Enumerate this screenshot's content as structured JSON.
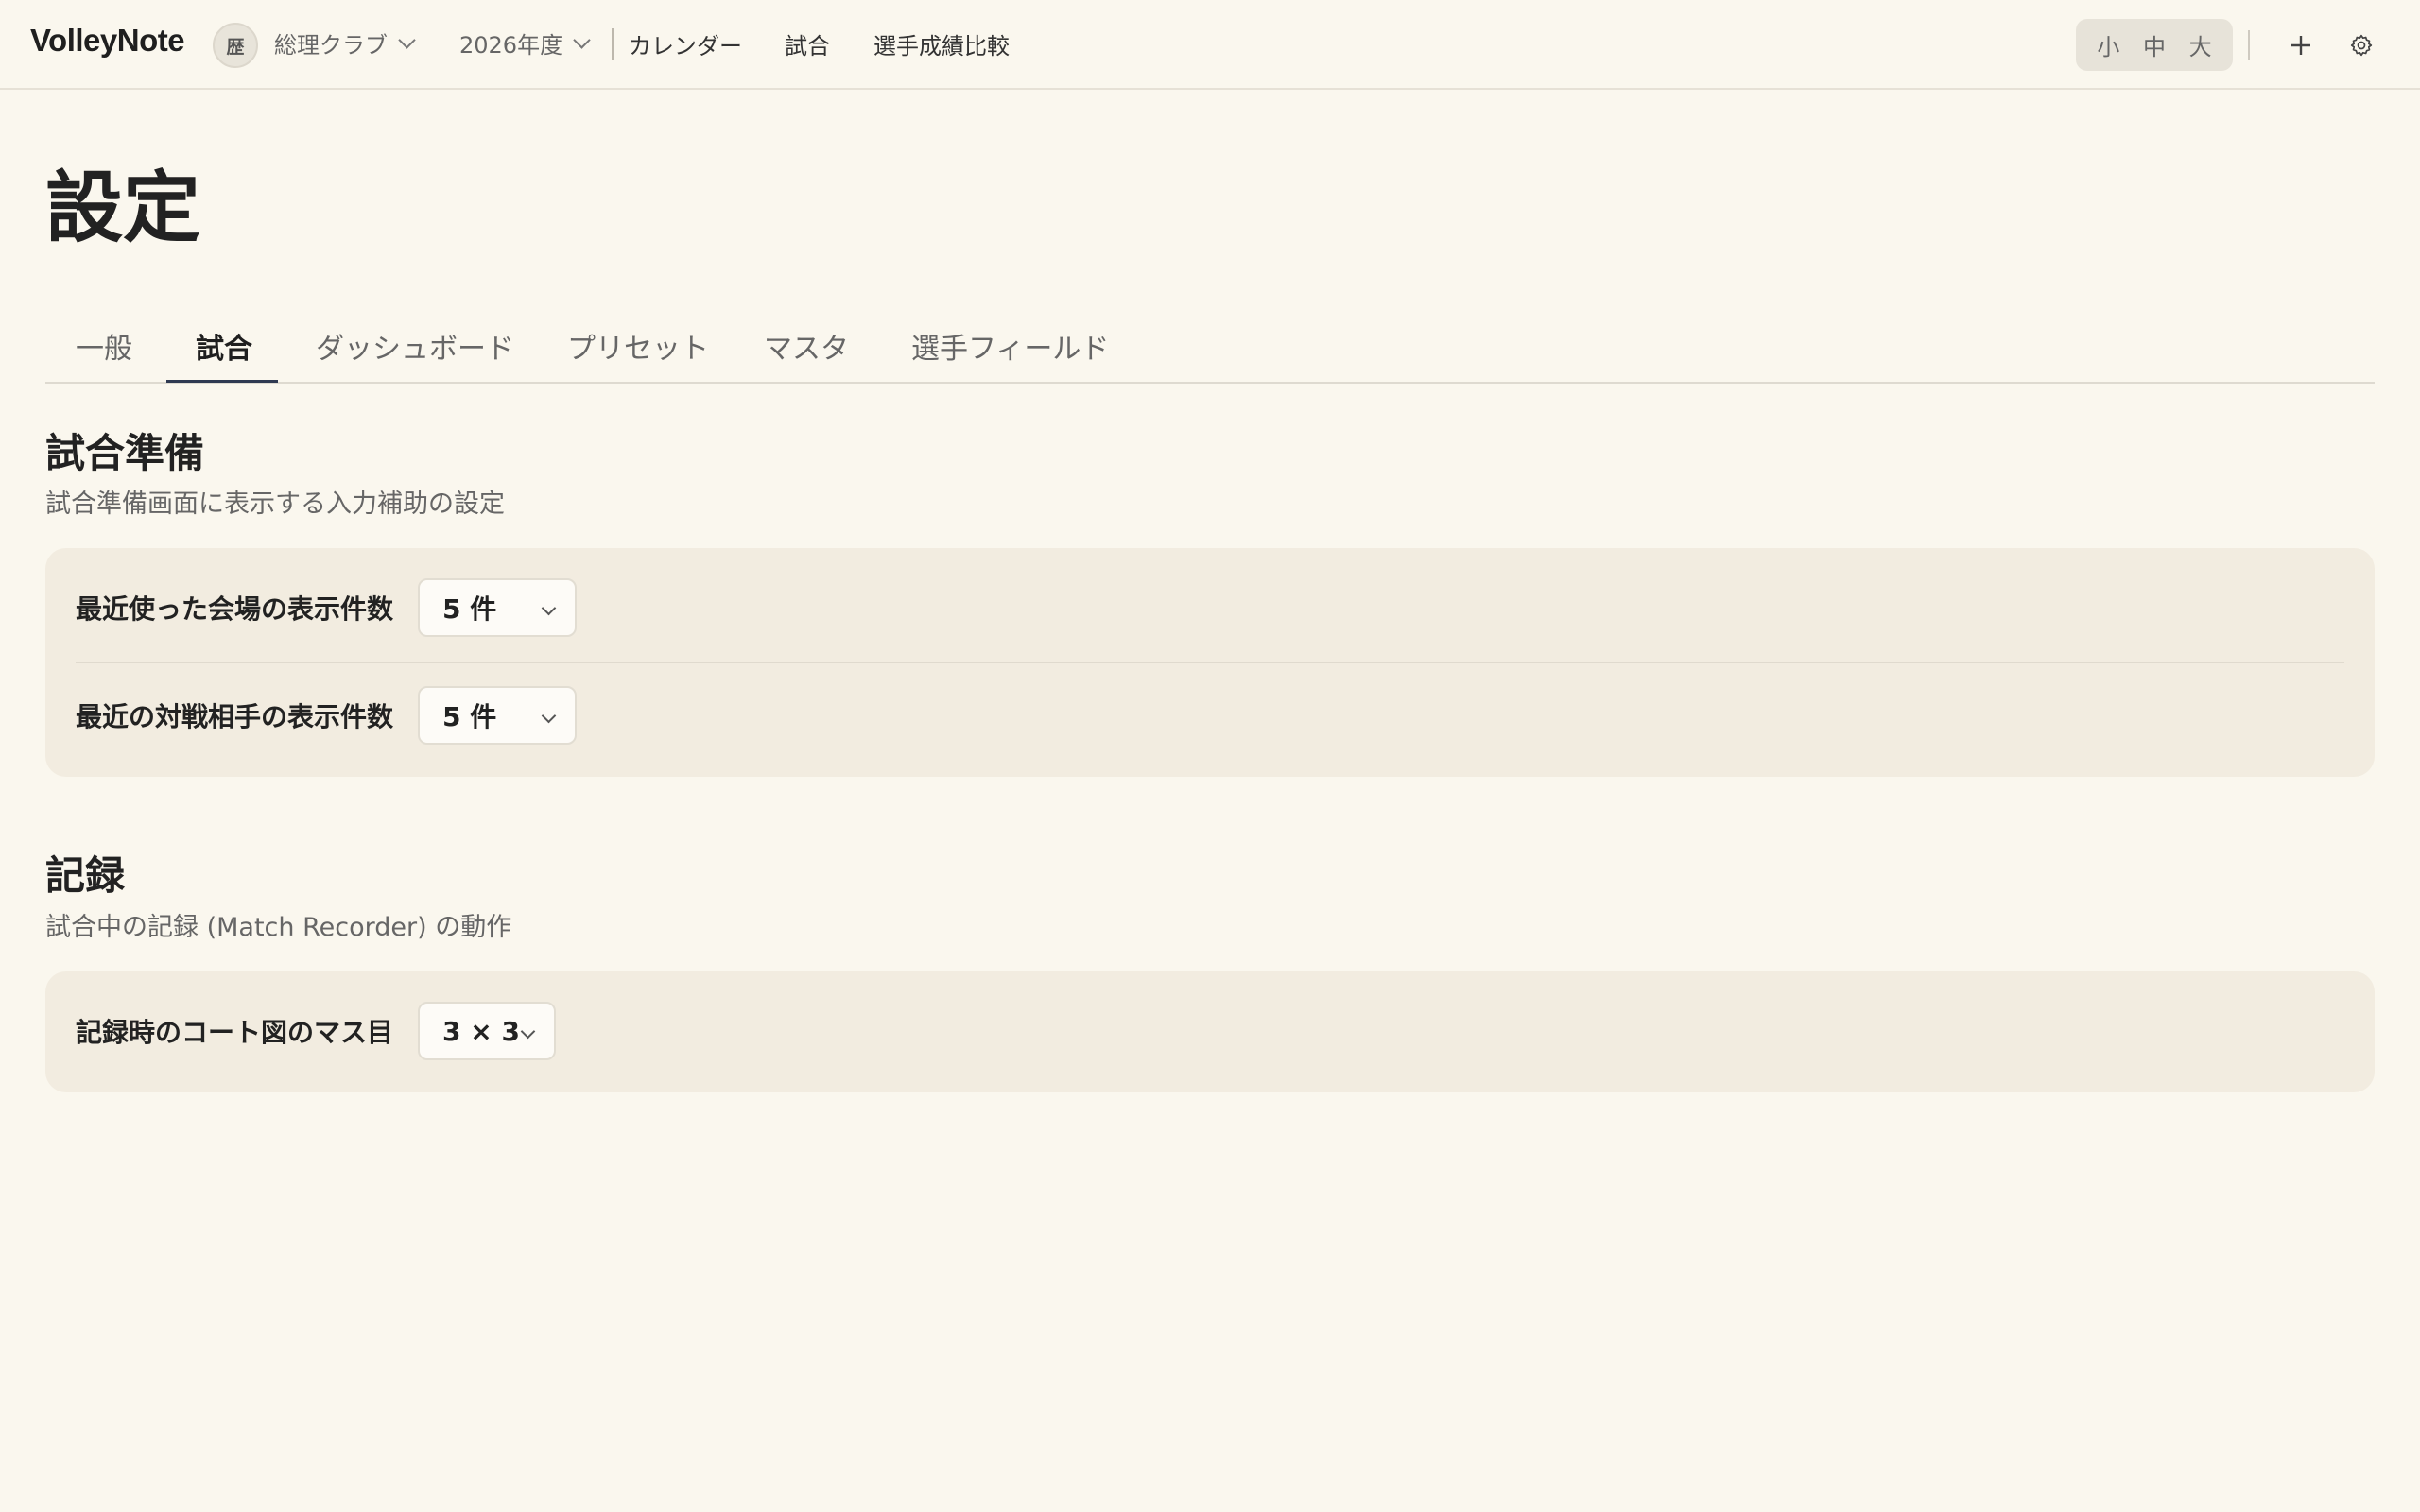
{
  "app": {
    "title": "VolleyNote"
  },
  "header": {
    "club_avatar": "歴",
    "club_name": "総理クラブ",
    "year": "2026年度",
    "nav": [
      "カレンダー",
      "試合",
      "選手成績比較"
    ],
    "font_size": [
      "小",
      "中",
      "大"
    ],
    "icons": [
      "plus-icon",
      "gear-icon"
    ]
  },
  "page": {
    "title": "設定",
    "tabs": [
      "一般",
      "試合",
      "ダッシュボード",
      "プリセット",
      "マスタ",
      "選手フィールド"
    ],
    "active_tab": "試合"
  },
  "sections": [
    {
      "title": "試合準備",
      "subtitle": "試合準備画面に表示する入力補助の設定",
      "rows": [
        {
          "label": "最近使った会場の表示件数",
          "value": "5 件"
        },
        {
          "label": "最近の対戦相手の表示件数",
          "value": "5 件"
        }
      ]
    },
    {
      "title": "記録",
      "subtitle": "試合中の記録 (Match Recorder) の動作",
      "rows": [
        {
          "label": "記録時のコート図のマス目",
          "value": "3 × 3"
        }
      ]
    }
  ],
  "colors": {
    "background": "#faf7ee",
    "panel": "#f2ece0",
    "tab_underline": "#2f3a52"
  }
}
